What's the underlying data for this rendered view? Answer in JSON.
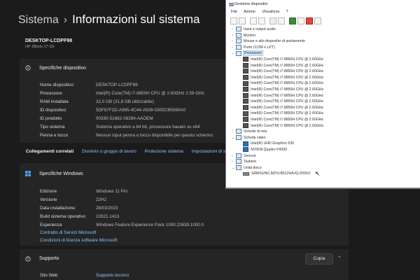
{
  "settings": {
    "breadcrumb_root": "Sistema",
    "breadcrumb_sep": "›",
    "page_title": "Informazioni sul sistema",
    "device_name": "DESKTOP-LCDPF98",
    "device_model": "HP ZBook 17 G5",
    "device_specs": {
      "header": "Specifiche dispositivo",
      "rows": [
        {
          "label": "Nome dispositivo",
          "value": "DESKTOP-LCDPF98"
        },
        {
          "label": "Processore",
          "value": "Intel(R) Core(TM) i7-8850H CPU @ 2.60GHz   2.59 GHz"
        },
        {
          "label": "RAM installata",
          "value": "32,0 GB (31,8 GB utilizzabile)"
        },
        {
          "label": "ID dispositivo",
          "value": "5DF87F2D-A995-4C44-A939-0305CB5560A0"
        },
        {
          "label": "ID prodotto",
          "value": "00330-51682-06284-AAOEM"
        },
        {
          "label": "Tipo sistema",
          "value": "Sistema operativo a 64 bit, processore basato su x64"
        },
        {
          "label": "Penna e tocco",
          "value": "Nessun input penna o tocco disponibile per questo schermo"
        }
      ]
    },
    "related": {
      "title": "Collegamenti correlati",
      "links": [
        "Dominio o gruppo di lavoro",
        "Protezione sistema",
        "Impostazioni di sis"
      ]
    },
    "windows_specs": {
      "header": "Specifiche Windows",
      "rows": [
        {
          "label": "Edizione",
          "value": "Windows 11 Pro"
        },
        {
          "label": "Versione",
          "value": "22H2"
        },
        {
          "label": "Data installazione:",
          "value": "28/03/2023"
        },
        {
          "label": "Build sistema operativo",
          "value": "22621.1413"
        },
        {
          "label": "Esperienza",
          "value": "Windows Feature Experience Pack 1000.22639.1000.0"
        }
      ],
      "links": [
        "Contratto di Servizi Microsoft",
        "Condizioni di licenza software Microsoft"
      ]
    },
    "support": {
      "header": "Supporto",
      "copy_label": "Copia",
      "row_label": "Sito Web",
      "row_value": "Supporto tecnico"
    }
  },
  "device_manager": {
    "title": "Gestione dispositivi",
    "menu": [
      "File",
      "Azione",
      "Visualizza",
      "?"
    ],
    "tree": [
      {
        "label": "Input e output audio",
        "kind": "cat",
        "exp": "›"
      },
      {
        "label": "Monitor",
        "kind": "cat",
        "exp": "›"
      },
      {
        "label": "Mouse e altri dispositivi di puntamento",
        "kind": "cat",
        "exp": "›"
      },
      {
        "label": "Porte (COM e LPT)",
        "kind": "cat",
        "exp": "›"
      },
      {
        "label": "Processori",
        "kind": "cat",
        "exp": "⌄",
        "selected": true
      },
      {
        "label": "Intel(R) Core(TM) i7-8850H CPU @ 2.60GHz",
        "kind": "cpu"
      },
      {
        "label": "Intel(R) Core(TM) i7-8850H CPU @ 2.60GHz",
        "kind": "cpu"
      },
      {
        "label": "Intel(R) Core(TM) i7-8850H CPU @ 2.60GHz",
        "kind": "cpu"
      },
      {
        "label": "Intel(R) Core(TM) i7-8850H CPU @ 2.60GHz",
        "kind": "cpu"
      },
      {
        "label": "Intel(R) Core(TM) i7-8850H CPU @ 2.60GHz",
        "kind": "cpu"
      },
      {
        "label": "Intel(R) Core(TM) i7-8850H CPU @ 2.60GHz",
        "kind": "cpu"
      },
      {
        "label": "Intel(R) Core(TM) i7-8850H CPU @ 2.60GHz",
        "kind": "cpu"
      },
      {
        "label": "Intel(R) Core(TM) i7-8850H CPU @ 2.60GHz",
        "kind": "cpu"
      },
      {
        "label": "Intel(R) Core(TM) i7-8850H CPU @ 2.60GHz",
        "kind": "cpu"
      },
      {
        "label": "Intel(R) Core(TM) i7-8850H CPU @ 2.60GHz",
        "kind": "cpu"
      },
      {
        "label": "Intel(R) Core(TM) i7-8850H CPU @ 2.60GHz",
        "kind": "cpu"
      },
      {
        "label": "Intel(R) Core(TM) i7-8850H CPU @ 2.60GHz",
        "kind": "cpu"
      },
      {
        "label": "Schede di rete",
        "kind": "cat",
        "exp": "›"
      },
      {
        "label": "Schede video",
        "kind": "cat",
        "exp": "⌄"
      },
      {
        "label": "Intel(R) UHD Graphics 630",
        "kind": "gpu"
      },
      {
        "label": "NVIDIA Quadro P4200",
        "kind": "gpu"
      },
      {
        "label": "Sensori",
        "kind": "cat",
        "exp": "›"
      },
      {
        "label": "Tastiere",
        "kind": "cat",
        "exp": "›"
      },
      {
        "label": "Unità disco",
        "kind": "cat",
        "exp": "⌄"
      },
      {
        "label": "SAMSUNG MZVLB512HAJQ-000H1",
        "kind": "disk"
      }
    ]
  },
  "colors": {
    "accent_link": "#8fc3ff",
    "settings_bg": "#1b1b1b",
    "card_bg": "#252525"
  }
}
